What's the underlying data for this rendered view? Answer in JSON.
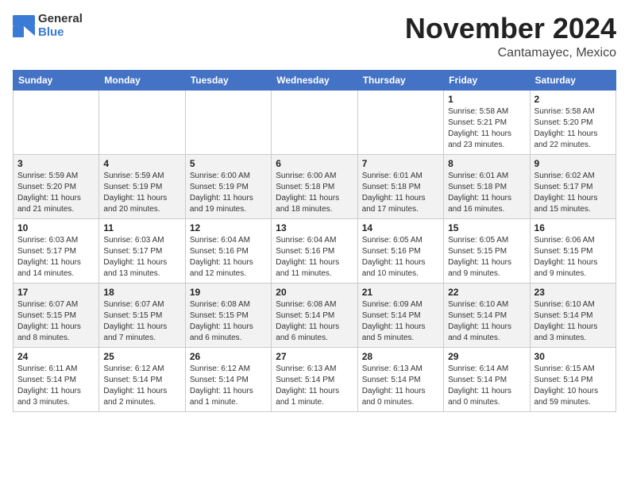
{
  "header": {
    "logo": {
      "general": "General",
      "blue": "Blue"
    },
    "title": "November 2024",
    "location": "Cantamayec, Mexico"
  },
  "calendar": {
    "days_of_week": [
      "Sunday",
      "Monday",
      "Tuesday",
      "Wednesday",
      "Thursday",
      "Friday",
      "Saturday"
    ],
    "weeks": [
      [
        {
          "day": "",
          "info": ""
        },
        {
          "day": "",
          "info": ""
        },
        {
          "day": "",
          "info": ""
        },
        {
          "day": "",
          "info": ""
        },
        {
          "day": "",
          "info": ""
        },
        {
          "day": "1",
          "info": "Sunrise: 5:58 AM\nSunset: 5:21 PM\nDaylight: 11 hours\nand 23 minutes."
        },
        {
          "day": "2",
          "info": "Sunrise: 5:58 AM\nSunset: 5:20 PM\nDaylight: 11 hours\nand 22 minutes."
        }
      ],
      [
        {
          "day": "3",
          "info": "Sunrise: 5:59 AM\nSunset: 5:20 PM\nDaylight: 11 hours\nand 21 minutes."
        },
        {
          "day": "4",
          "info": "Sunrise: 5:59 AM\nSunset: 5:19 PM\nDaylight: 11 hours\nand 20 minutes."
        },
        {
          "day": "5",
          "info": "Sunrise: 6:00 AM\nSunset: 5:19 PM\nDaylight: 11 hours\nand 19 minutes."
        },
        {
          "day": "6",
          "info": "Sunrise: 6:00 AM\nSunset: 5:18 PM\nDaylight: 11 hours\nand 18 minutes."
        },
        {
          "day": "7",
          "info": "Sunrise: 6:01 AM\nSunset: 5:18 PM\nDaylight: 11 hours\nand 17 minutes."
        },
        {
          "day": "8",
          "info": "Sunrise: 6:01 AM\nSunset: 5:18 PM\nDaylight: 11 hours\nand 16 minutes."
        },
        {
          "day": "9",
          "info": "Sunrise: 6:02 AM\nSunset: 5:17 PM\nDaylight: 11 hours\nand 15 minutes."
        }
      ],
      [
        {
          "day": "10",
          "info": "Sunrise: 6:03 AM\nSunset: 5:17 PM\nDaylight: 11 hours\nand 14 minutes."
        },
        {
          "day": "11",
          "info": "Sunrise: 6:03 AM\nSunset: 5:17 PM\nDaylight: 11 hours\nand 13 minutes."
        },
        {
          "day": "12",
          "info": "Sunrise: 6:04 AM\nSunset: 5:16 PM\nDaylight: 11 hours\nand 12 minutes."
        },
        {
          "day": "13",
          "info": "Sunrise: 6:04 AM\nSunset: 5:16 PM\nDaylight: 11 hours\nand 11 minutes."
        },
        {
          "day": "14",
          "info": "Sunrise: 6:05 AM\nSunset: 5:16 PM\nDaylight: 11 hours\nand 10 minutes."
        },
        {
          "day": "15",
          "info": "Sunrise: 6:05 AM\nSunset: 5:15 PM\nDaylight: 11 hours\nand 9 minutes."
        },
        {
          "day": "16",
          "info": "Sunrise: 6:06 AM\nSunset: 5:15 PM\nDaylight: 11 hours\nand 9 minutes."
        }
      ],
      [
        {
          "day": "17",
          "info": "Sunrise: 6:07 AM\nSunset: 5:15 PM\nDaylight: 11 hours\nand 8 minutes."
        },
        {
          "day": "18",
          "info": "Sunrise: 6:07 AM\nSunset: 5:15 PM\nDaylight: 11 hours\nand 7 minutes."
        },
        {
          "day": "19",
          "info": "Sunrise: 6:08 AM\nSunset: 5:15 PM\nDaylight: 11 hours\nand 6 minutes."
        },
        {
          "day": "20",
          "info": "Sunrise: 6:08 AM\nSunset: 5:14 PM\nDaylight: 11 hours\nand 6 minutes."
        },
        {
          "day": "21",
          "info": "Sunrise: 6:09 AM\nSunset: 5:14 PM\nDaylight: 11 hours\nand 5 minutes."
        },
        {
          "day": "22",
          "info": "Sunrise: 6:10 AM\nSunset: 5:14 PM\nDaylight: 11 hours\nand 4 minutes."
        },
        {
          "day": "23",
          "info": "Sunrise: 6:10 AM\nSunset: 5:14 PM\nDaylight: 11 hours\nand 3 minutes."
        }
      ],
      [
        {
          "day": "24",
          "info": "Sunrise: 6:11 AM\nSunset: 5:14 PM\nDaylight: 11 hours\nand 3 minutes."
        },
        {
          "day": "25",
          "info": "Sunrise: 6:12 AM\nSunset: 5:14 PM\nDaylight: 11 hours\nand 2 minutes."
        },
        {
          "day": "26",
          "info": "Sunrise: 6:12 AM\nSunset: 5:14 PM\nDaylight: 11 hours\nand 1 minute."
        },
        {
          "day": "27",
          "info": "Sunrise: 6:13 AM\nSunset: 5:14 PM\nDaylight: 11 hours\nand 1 minute."
        },
        {
          "day": "28",
          "info": "Sunrise: 6:13 AM\nSunset: 5:14 PM\nDaylight: 11 hours\nand 0 minutes."
        },
        {
          "day": "29",
          "info": "Sunrise: 6:14 AM\nSunset: 5:14 PM\nDaylight: 11 hours\nand 0 minutes."
        },
        {
          "day": "30",
          "info": "Sunrise: 6:15 AM\nSunset: 5:14 PM\nDaylight: 10 hours\nand 59 minutes."
        }
      ]
    ]
  }
}
